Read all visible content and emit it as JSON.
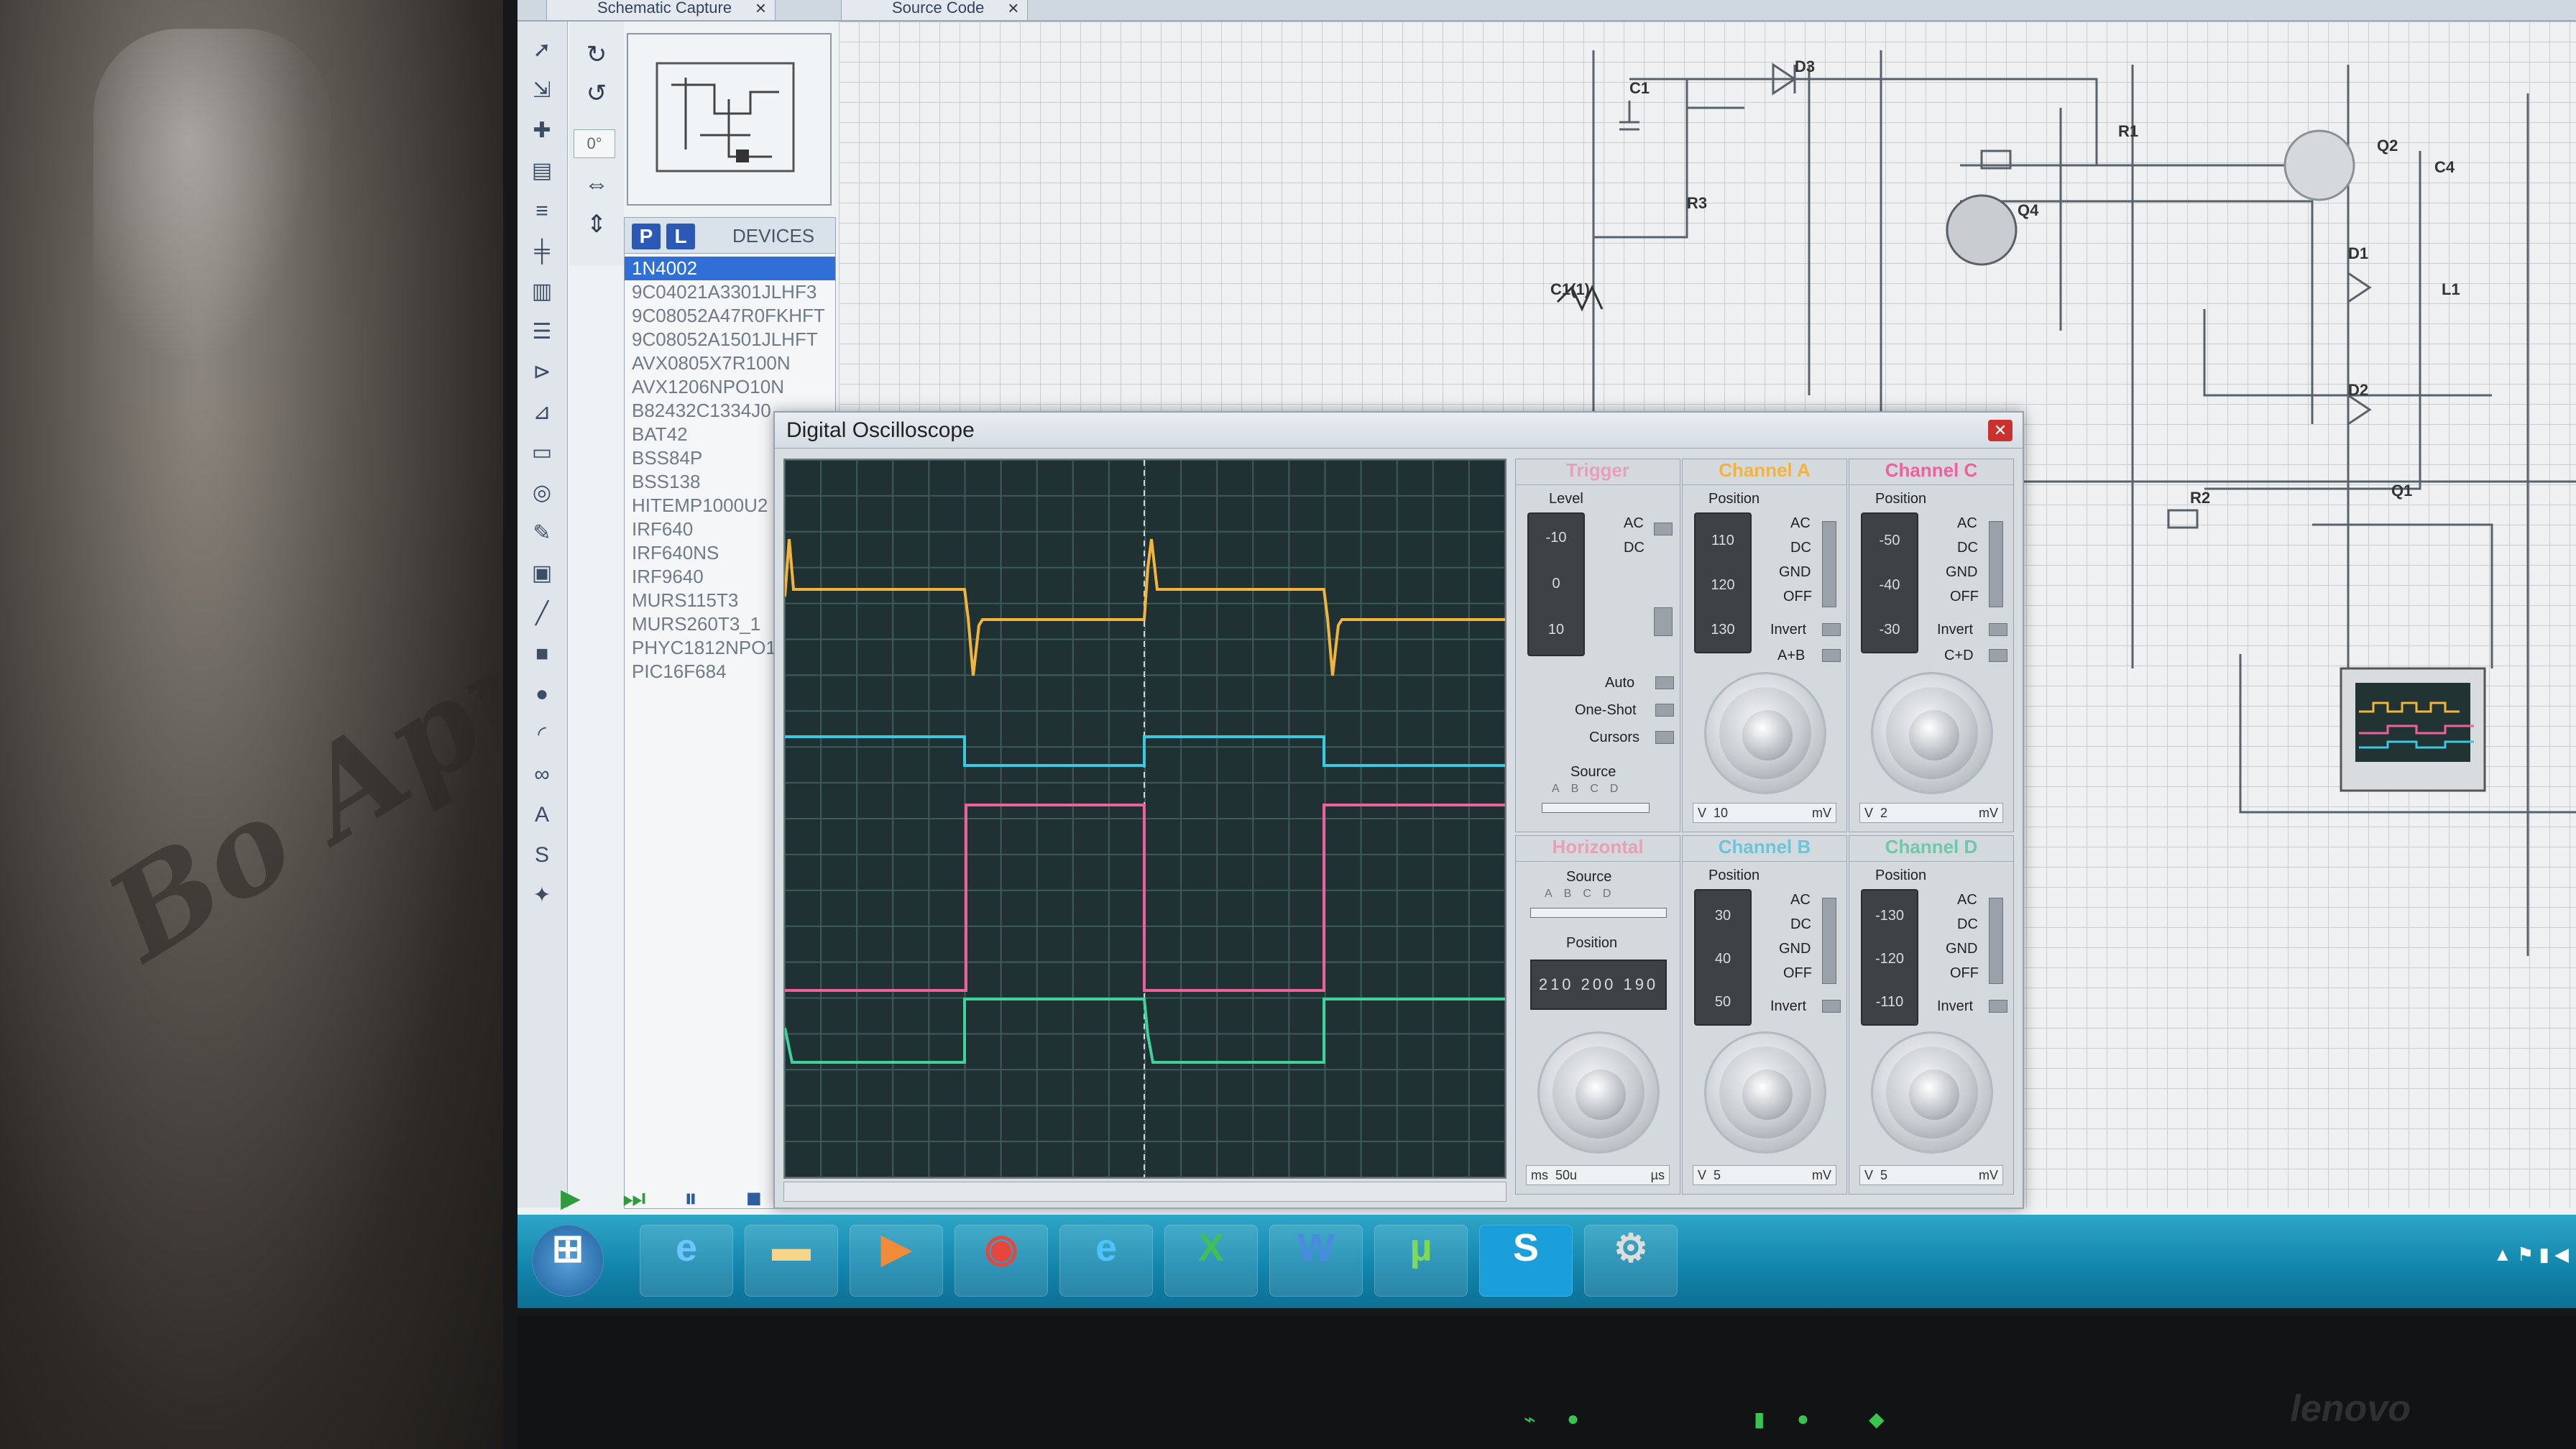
{
  "tabs": {
    "schematic": {
      "label": "Schematic Capture"
    },
    "source": {
      "label": "Source Code"
    }
  },
  "toolbar": {
    "rotation_angle": "0°"
  },
  "devices": {
    "p_label": "P",
    "l_label": "L",
    "title": "DEVICES",
    "items": [
      "1N4002",
      "9C04021A3301JLHF3",
      "9C08052A47R0FKHFT",
      "9C08052A1501JLHFT",
      "AVX0805X7R100N",
      "AVX1206NPO10N",
      "B82432C1334J0",
      "BAT42",
      "BSS84P",
      "BSS138",
      "HITEMP1000U2",
      "IRF640",
      "IRF640NS",
      "IRF9640",
      "MURS115T3",
      "MURS260T3_1",
      "PHYC1812NPO1",
      "PIC16F684"
    ],
    "selected_index": 0
  },
  "schematic": {
    "labels": [
      "C1",
      "D3",
      "R3",
      "Q4",
      "R1",
      "Q2",
      "C4",
      "D1",
      "D2",
      "L1",
      "R2",
      "Q1",
      "C1(1)"
    ]
  },
  "oscilloscope": {
    "title": "Digital Oscilloscope",
    "trigger": {
      "title": "Trigger",
      "level_label": "Level",
      "level_ticks": [
        "-10",
        "0",
        "10"
      ],
      "coupling": [
        "AC",
        "DC"
      ],
      "auto_label": "Auto",
      "oneshot_label": "One-Shot",
      "cursors_label": "Cursors",
      "source_label": "Source",
      "source_options": [
        "A",
        "B",
        "C",
        "D"
      ]
    },
    "horizontal": {
      "title": "Horizontal",
      "source_label": "Source",
      "source_options": [
        "A",
        "B",
        "C",
        "D"
      ],
      "position_label": "Position",
      "position_ticks": "210 200 190",
      "units_left": "ms",
      "units_right": "µs",
      "value": "50u"
    },
    "channel_a": {
      "title": "Channel A",
      "position_label": "Position",
      "ticks": [
        "110",
        "120",
        "130"
      ],
      "options": [
        "AC",
        "DC",
        "GND",
        "OFF",
        "Invert",
        "A+B"
      ],
      "unit_left": "V",
      "unit_right": "mV",
      "value": "10"
    },
    "channel_b": {
      "title": "Channel B",
      "position_label": "Position",
      "ticks": [
        "30",
        "40",
        "50"
      ],
      "options": [
        "AC",
        "DC",
        "GND",
        "OFF",
        "Invert"
      ],
      "unit_left": "V",
      "unit_right": "mV",
      "value": "5"
    },
    "channel_c": {
      "title": "Channel C",
      "position_label": "Position",
      "ticks": [
        "-50",
        "-40",
        "-30"
      ],
      "options": [
        "AC",
        "DC",
        "GND",
        "OFF",
        "Invert",
        "C+D"
      ],
      "unit_left": "V",
      "unit_right": "mV",
      "value": "2"
    },
    "channel_d": {
      "title": "Channel D",
      "position_label": "Position",
      "ticks": [
        "-130",
        "-120",
        "-110"
      ],
      "options": [
        "AC",
        "DC",
        "GND",
        "OFF",
        "Invert"
      ],
      "unit_left": "V",
      "unit_right": "mV",
      "value": "5"
    },
    "colors": {
      "channel_a": "#f2b43a",
      "channel_b": "#39c9e0",
      "channel_c": "#f0609c",
      "channel_d": "#3fd39a",
      "screen": "#1f3133",
      "grid": "#3f5a5c"
    }
  },
  "simulation": {
    "controls": [
      "play-icon",
      "step-icon",
      "pause-icon",
      "stop-icon"
    ]
  },
  "taskbar": {
    "apps": [
      "windows-start-icon",
      "ie-icon",
      "explorer-icon",
      "media-player-icon",
      "chrome-icon",
      "edge-icon",
      "X",
      "W",
      "µ",
      "S",
      "settings-icon"
    ]
  },
  "bezel": {
    "brand": "lenovo"
  }
}
